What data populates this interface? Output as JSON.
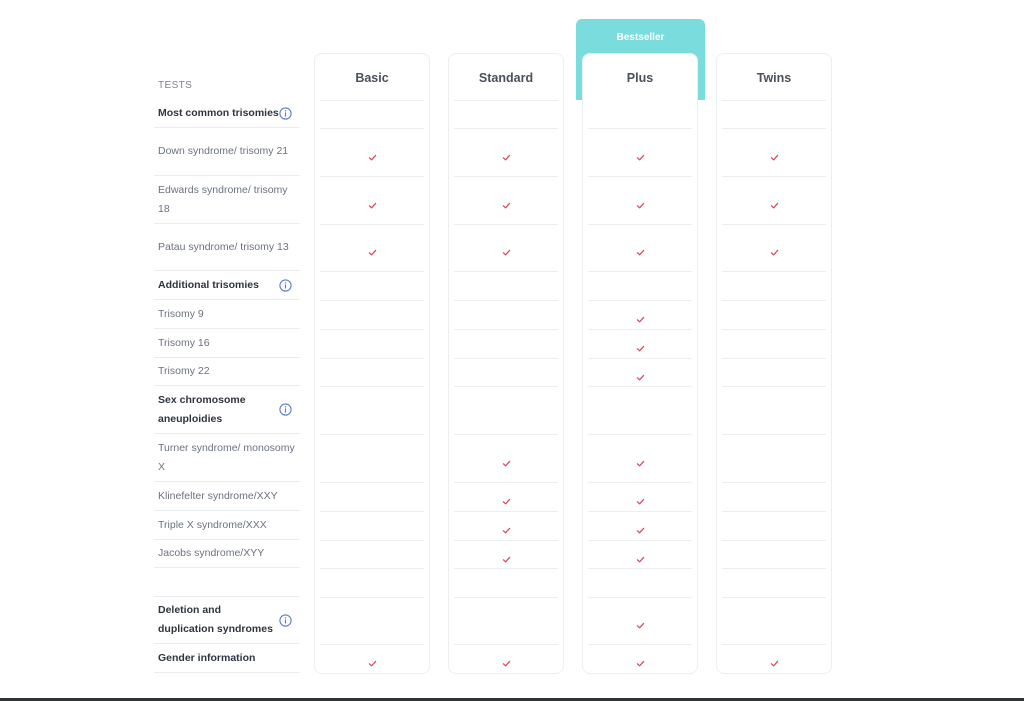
{
  "table": {
    "tests_header": "TESTS",
    "bestseller_label": "Bestseller",
    "plans": [
      {
        "name": "Basic"
      },
      {
        "name": "Standard"
      },
      {
        "name": "Plus"
      },
      {
        "name": "Twins"
      }
    ],
    "rows": [
      {
        "label": "Most common trisomies",
        "group": true,
        "info": true,
        "checks": [
          false,
          false,
          false,
          false
        ]
      },
      {
        "label": "Down syndrome/ trisomy 21",
        "group": false,
        "info": false,
        "checks": [
          true,
          true,
          true,
          true
        ]
      },
      {
        "label": "Edwards syndrome/ trisomy 18",
        "group": false,
        "info": false,
        "checks": [
          true,
          true,
          true,
          true
        ]
      },
      {
        "label": "Patau syndrome/ trisomy 13",
        "group": false,
        "info": false,
        "checks": [
          true,
          true,
          true,
          true
        ]
      },
      {
        "label": "Additional trisomies",
        "group": true,
        "info": true,
        "checks": [
          false,
          false,
          false,
          false
        ]
      },
      {
        "label": "Trisomy 9",
        "group": false,
        "info": false,
        "checks": [
          false,
          false,
          true,
          false
        ]
      },
      {
        "label": "Trisomy 16",
        "group": false,
        "info": false,
        "checks": [
          false,
          false,
          true,
          false
        ]
      },
      {
        "label": "Trisomy 22",
        "group": false,
        "info": false,
        "checks": [
          false,
          false,
          true,
          false
        ]
      },
      {
        "label": "Sex chromosome aneuploidies",
        "group": true,
        "info": true,
        "checks": [
          false,
          false,
          false,
          false
        ]
      },
      {
        "label": "Turner syndrome/ monosomy X",
        "group": false,
        "info": false,
        "checks": [
          false,
          true,
          true,
          false
        ]
      },
      {
        "label": "Klinefelter syndrome/XXY",
        "group": false,
        "info": false,
        "checks": [
          false,
          true,
          true,
          false
        ]
      },
      {
        "label": "Triple X syndrome/XXX",
        "group": false,
        "info": false,
        "checks": [
          false,
          true,
          true,
          false
        ]
      },
      {
        "label": "Jacobs syndrome/XYY",
        "group": false,
        "info": false,
        "checks": [
          false,
          true,
          true,
          false
        ]
      },
      {
        "label": "",
        "group": false,
        "info": false,
        "checks": [
          false,
          false,
          false,
          false
        ]
      },
      {
        "label": "Deletion and duplication syndromes",
        "group": true,
        "info": true,
        "checks": [
          false,
          false,
          true,
          false
        ]
      },
      {
        "label": "Gender information",
        "group": true,
        "info": false,
        "checks": [
          true,
          true,
          true,
          true
        ]
      }
    ]
  },
  "icons": {
    "check": "check-icon",
    "info": "info-icon"
  },
  "colors": {
    "accent": "#7adcdc",
    "check": "#e0485e",
    "info": "#5b7bd5",
    "border": "#eceef1"
  }
}
